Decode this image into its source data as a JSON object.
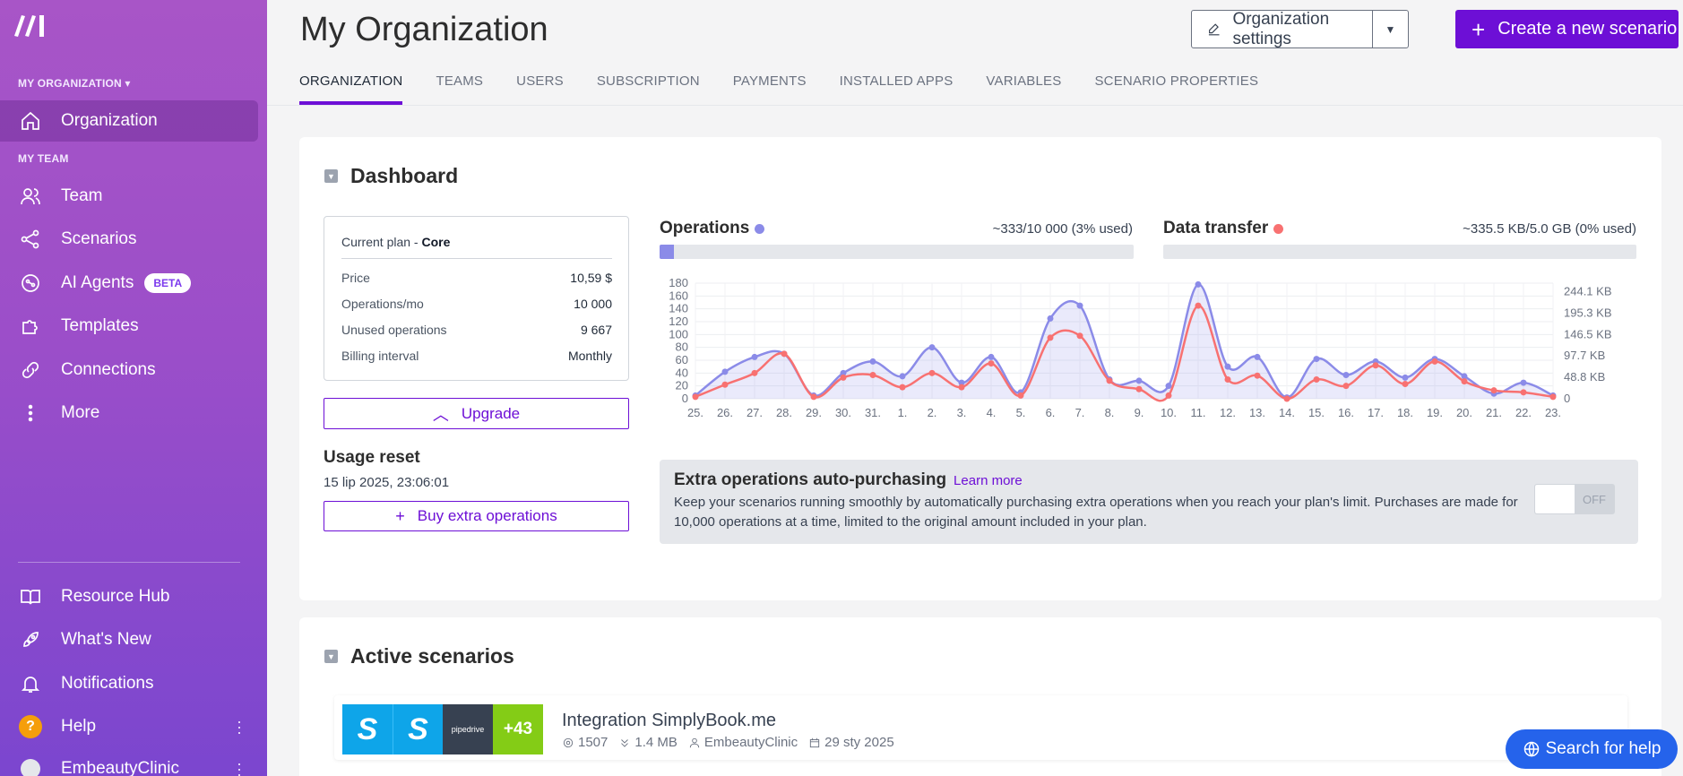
{
  "sidebar": {
    "org_section": "MY ORGANIZATION",
    "team_section": "MY TEAM",
    "items": [
      {
        "label": "Organization"
      },
      {
        "label": "Team"
      },
      {
        "label": "Scenarios"
      },
      {
        "label": "AI Agents",
        "badge": "BETA"
      },
      {
        "label": "Templates"
      },
      {
        "label": "Connections"
      },
      {
        "label": "More"
      }
    ],
    "bottom": [
      {
        "label": "Resource Hub"
      },
      {
        "label": "What's New"
      },
      {
        "label": "Notifications"
      },
      {
        "label": "Help",
        "badge": "?"
      },
      {
        "label": "EmbeautyClinic"
      }
    ]
  },
  "header": {
    "title": "My Organization",
    "settings_label": "Organization settings",
    "create_label": "Create a new scenario",
    "tabs": [
      "ORGANIZATION",
      "TEAMS",
      "USERS",
      "SUBSCRIPTION",
      "PAYMENTS",
      "INSTALLED APPS",
      "VARIABLES",
      "SCENARIO PROPERTIES"
    ]
  },
  "dashboard": {
    "title": "Dashboard",
    "plan": {
      "label": "Current plan - ",
      "name": "Core",
      "rows": [
        {
          "k": "Price",
          "v": "10,59 $"
        },
        {
          "k": "Operations/mo",
          "v": "10 000"
        },
        {
          "k": "Unused operations",
          "v": "9 667"
        },
        {
          "k": "Billing interval",
          "v": "Monthly"
        }
      ]
    },
    "upgrade_label": "Upgrade",
    "usage_reset_title": "Usage reset",
    "usage_reset_date": "15 lip 2025, 23:06:01",
    "buy_extra_label": "Buy extra operations",
    "operations": {
      "title": "Operations",
      "used": "~333/10 000 (3% used)",
      "fraction": 0.03
    },
    "data_transfer": {
      "title": "Data transfer",
      "used": "~335.5 KB/5.0 GB (0% used)",
      "fraction": 0.0
    },
    "extra": {
      "title": "Extra operations auto-purchasing",
      "learn_more": "Learn more",
      "description": "Keep your scenarios running smoothly by automatically purchasing extra operations when you reach your plan's limit. Purchases are made for 10,000 operations at a time, limited to the original amount included in your plan.",
      "toggle": "OFF"
    }
  },
  "chart_data": {
    "type": "line",
    "x": [
      "25.",
      "26.",
      "27.",
      "28.",
      "29.",
      "30.",
      "31.",
      "1.",
      "2.",
      "3.",
      "4.",
      "5.",
      "6.",
      "7.",
      "8.",
      "9.",
      "10.",
      "11.",
      "12.",
      "13.",
      "14.",
      "15.",
      "16.",
      "17.",
      "18.",
      "19.",
      "20.",
      "21.",
      "22.",
      "23."
    ],
    "left_ticks": [
      "0",
      "20",
      "40",
      "60",
      "80",
      "100",
      "120",
      "140",
      "160",
      "180"
    ],
    "right_ticks": [
      "0",
      "48.8 KB",
      "97.7 KB",
      "146.5 KB",
      "195.3 KB",
      "244.1 KB"
    ],
    "ylim": [
      0,
      180
    ],
    "series": [
      {
        "color": "#8b8be8",
        "values": [
          5,
          42,
          65,
          70,
          5,
          40,
          58,
          35,
          80,
          25,
          65,
          10,
          125,
          145,
          30,
          28,
          20,
          178,
          50,
          65,
          2,
          62,
          37,
          58,
          33,
          62,
          35,
          8,
          25,
          5
        ]
      },
      {
        "color": "#f87171",
        "values": [
          3,
          22,
          40,
          70,
          3,
          33,
          37,
          18,
          40,
          18,
          55,
          5,
          95,
          98,
          28,
          15,
          5,
          145,
          30,
          36,
          0,
          30,
          20,
          52,
          23,
          58,
          27,
          13,
          10,
          3
        ]
      }
    ],
    "colors": {
      "operations": "#8b8be8",
      "data_transfer": "#f87171"
    }
  },
  "active": {
    "title": "Active scenarios",
    "scenario": {
      "tiles": [
        "S",
        "S",
        "pipedrive",
        "+43"
      ],
      "name": "Integration SimplyBook.me",
      "operations": "1507",
      "data": "1.4 MB",
      "owner": "EmbeautyClinic",
      "date": "29 sty 2025"
    }
  },
  "help_button": "Search for help"
}
